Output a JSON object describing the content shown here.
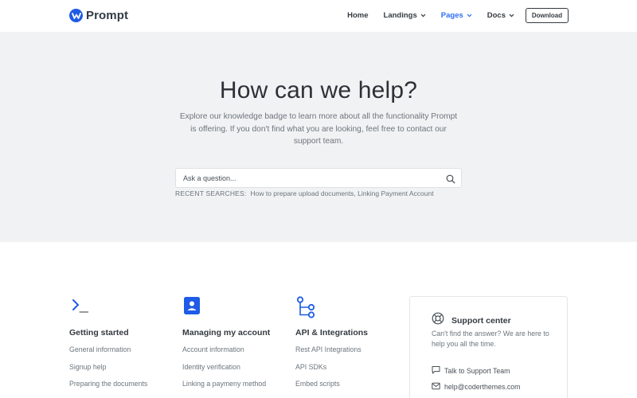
{
  "brand": {
    "name": "Prompt",
    "color": "#1f5be6"
  },
  "nav": {
    "items": [
      {
        "label": "Home",
        "has_dropdown": false,
        "active": false
      },
      {
        "label": "Landings",
        "has_dropdown": true,
        "active": false
      },
      {
        "label": "Pages",
        "has_dropdown": true,
        "active": true
      },
      {
        "label": "Docs",
        "has_dropdown": true,
        "active": false
      }
    ],
    "download_label": "Download"
  },
  "hero": {
    "title": "How can we help?",
    "description": "Explore our knowledge badge to learn more about all the functionality Prompt is offering. If you don't find what you are looking, feel free to contact our support team.",
    "search": {
      "placeholder": "Ask a question...",
      "value": "",
      "icon": "search-icon"
    },
    "recent_label": "Recent Searches:",
    "recent_items": "How to prepare upload documents, Linking Payment Account"
  },
  "categories": [
    {
      "icon": "terminal-icon",
      "title": "Getting started",
      "links": [
        "General information",
        "Signup help",
        "Preparing the documents"
      ]
    },
    {
      "icon": "user-card-icon",
      "title": "Managing my account",
      "links": [
        "Account information",
        "Identity verification",
        "Linking a paymeny method"
      ]
    },
    {
      "icon": "integration-flow-icon",
      "title": "API & Integrations",
      "links": [
        "Rest API Integrations",
        "API SDKs",
        "Embed scripts"
      ]
    }
  ],
  "support": {
    "icon": "lifebuoy-icon",
    "title": "Support center",
    "description": "Can't find the answer? We are here to help you all the time.",
    "chat_label": "Talk to Support Team",
    "email": "help@coderthemes.com"
  },
  "colors": {
    "accent": "#2d6ef5",
    "hero_bg": "#f1f2f3",
    "text_dark": "#343a40",
    "text_muted": "#6c757d"
  }
}
